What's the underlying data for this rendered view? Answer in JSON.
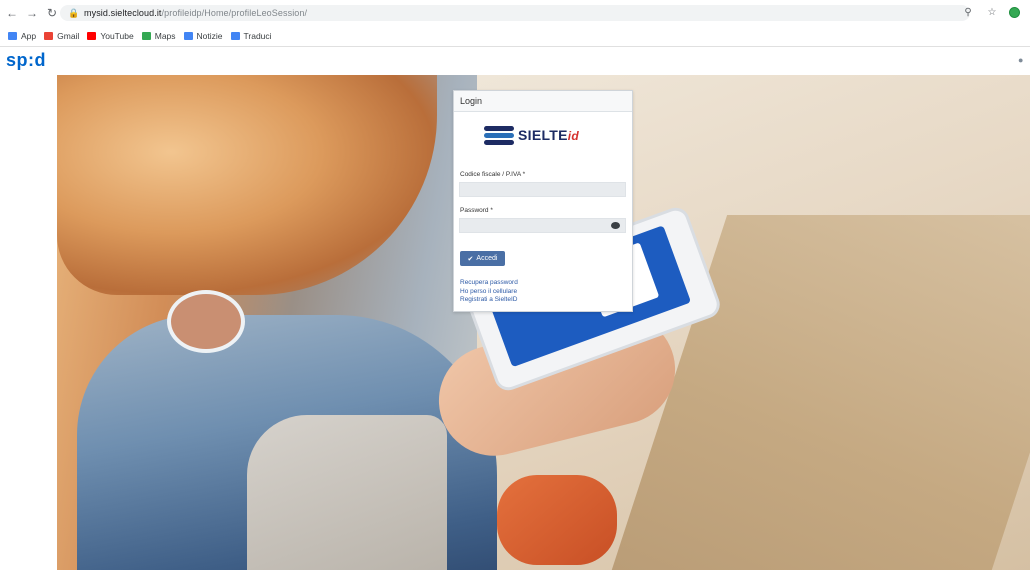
{
  "browser": {
    "url_host": "mysid.sieltecloud.it",
    "url_path": "/profileidp/Home/profileLeoSession/",
    "bookmarks": [
      {
        "label": "App",
        "color": "#4285f4"
      },
      {
        "label": "Gmail",
        "color": "#ea4335"
      },
      {
        "label": "YouTube",
        "color": "#ff0000"
      },
      {
        "label": "Maps",
        "color": "#34a853"
      },
      {
        "label": "Notizie",
        "color": "#4285f4"
      },
      {
        "label": "Traduci",
        "color": "#4285f4"
      }
    ],
    "icons": {
      "back": "back-arrow-icon",
      "forward": "forward-arrow-icon",
      "reload": "reload-icon",
      "lock": "lock-icon"
    }
  },
  "site": {
    "logo": "sp:d",
    "brand_color": "#0066cc"
  },
  "login": {
    "title": "Login",
    "brand_name": "SIELTE",
    "brand_suffix": "id",
    "fiscal_code_label": "Codice fiscale / P.IVA *",
    "fiscal_code_value": "",
    "password_label": "Password *",
    "password_value": "",
    "submit_label": "Accedi",
    "links": [
      "Recupera password",
      "Ho perso il cellulare",
      "Registrati a SielteID"
    ],
    "button_color": "#4a6fa5"
  }
}
